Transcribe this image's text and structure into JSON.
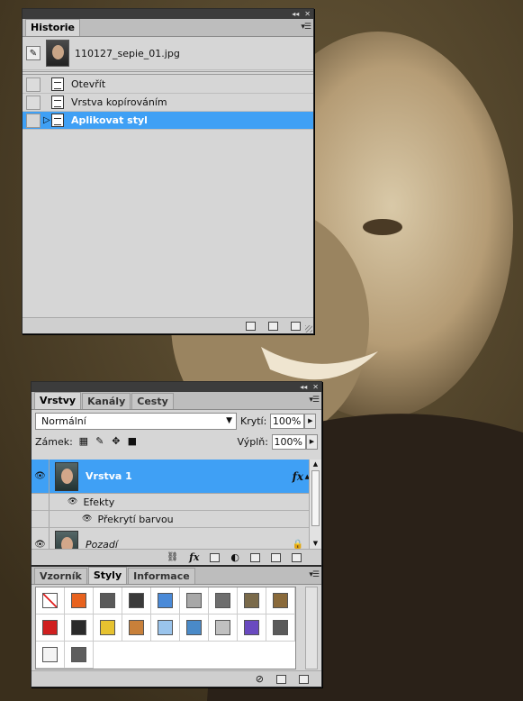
{
  "history_panel": {
    "tab": "Historie",
    "snapshot_name": "110127_sepie_01.jpg",
    "states": [
      {
        "label": "Otevřít",
        "selected": false
      },
      {
        "label": "Vrstva kopírováním",
        "selected": false
      },
      {
        "label": "Aplikovat styl",
        "selected": true
      }
    ],
    "bottom_icons": [
      "new-document-from-state-icon",
      "new-snapshot-icon",
      "trash-icon"
    ]
  },
  "layers_panel": {
    "tabs": [
      "Vrstvy",
      "Kanály",
      "Cesty"
    ],
    "active_tab": "Vrstvy",
    "blend_mode": "Normální",
    "opacity_label": "Krytí:",
    "opacity_value": "100%",
    "lock_label": "Zámek:",
    "fill_label": "Výplň:",
    "fill_value": "100%",
    "layers": [
      {
        "name": "Vrstva 1",
        "selected": true,
        "has_fx": true,
        "fx_label": "fx"
      },
      {
        "name": "Pozadí",
        "selected": false,
        "italic": true,
        "locked": true
      }
    ],
    "effects_label": "Efekty",
    "effect_item": "Překrytí barvou",
    "bottom_icons": [
      "link-icon",
      "fx-icon",
      "mask-icon",
      "adjustment-icon",
      "group-icon",
      "new-layer-icon",
      "trash-icon"
    ]
  },
  "styles_panel": {
    "tabs": [
      "Vzorník",
      "Styly",
      "Informace"
    ],
    "active_tab": "Styly",
    "swatches": [
      "#ffffff",
      "#e8621e",
      "#5a5a5a",
      "#3a3a3a",
      "#4a8ad8",
      "#a8a8a8",
      "#6e6e6e",
      "#7a6a4a",
      "#8a6a3a",
      "#d02020",
      "#2a2a2a",
      "#e6c230",
      "#c8803a",
      "#9ac4ec",
      "#4a8ac8",
      "#c0c0c0",
      "#6a4ac0",
      "#5a5a5a",
      "#f4f4f4",
      "#5e5e5e"
    ],
    "bottom_icons": [
      "clear-style-icon",
      "new-style-icon",
      "trash-icon"
    ]
  },
  "colors": {
    "selection": "#3fa0f5",
    "panel_bg": "#d6d6d6",
    "titlebar": "#3c3c3c"
  }
}
